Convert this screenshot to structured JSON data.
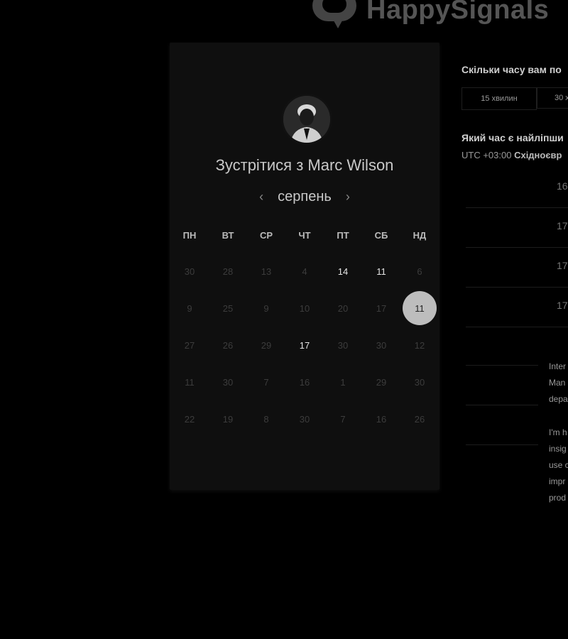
{
  "brand": {
    "name": "HappySignals"
  },
  "card": {
    "title": "Зустрітися з Marc Wilson",
    "month": "серпень",
    "prev_label": "‹",
    "next_label": "›",
    "weekdays": [
      "ПН",
      "ВТ",
      "СР",
      "ЧТ",
      "ПТ",
      "СБ",
      "НД"
    ],
    "weeks": [
      [
        "30",
        "28",
        "13",
        "4",
        "14",
        "11",
        "6"
      ],
      [
        "9",
        "25",
        "9",
        "10",
        "20",
        "17",
        "11"
      ],
      [
        "27",
        "26",
        "29",
        "17",
        "30",
        "30",
        "12"
      ],
      [
        "11",
        "30",
        "7",
        "16",
        "1",
        "29",
        "30"
      ],
      [
        "22",
        "19",
        "8",
        "30",
        "7",
        "16",
        "26"
      ]
    ],
    "available_days": [
      "0-4",
      "0-5",
      "2-3"
    ],
    "selected_day": "1-6"
  },
  "right": {
    "duration_question": "Скільки часу вам по",
    "durations": [
      "15 хвилин",
      "30 х"
    ],
    "time_question": "Який час є найліпши",
    "timezone_prefix": "UTC +03:00",
    "timezone_name": "Східноєвр",
    "slots": [
      "16",
      "17",
      "17",
      "17"
    ],
    "bio_lines_1": [
      "Inter",
      "Man",
      "depa"
    ],
    "bio_lines_2": [
      "I'm h",
      "insig",
      "use c",
      "impr",
      "prod"
    ]
  },
  "colors": {
    "background": "#000000",
    "card": "#0f0f0f",
    "selected": "#bdbdbd"
  }
}
